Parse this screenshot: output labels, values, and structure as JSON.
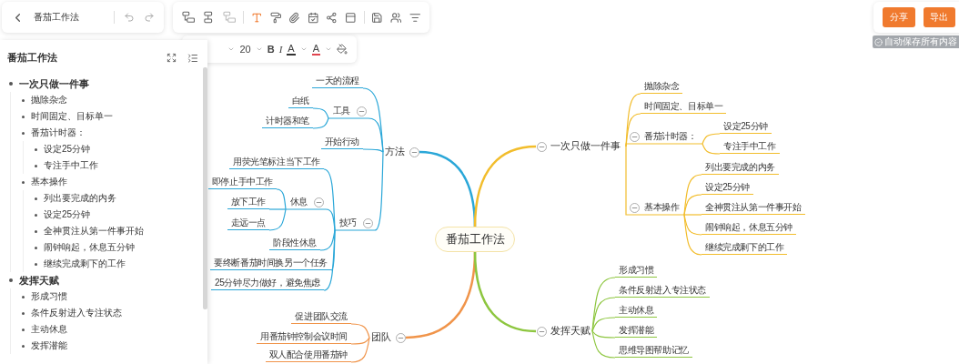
{
  "document": {
    "title": "番茄工作法"
  },
  "format_bar": {
    "font_size": "20",
    "bold": "B",
    "italic": "I",
    "font_color": {
      "label": "A",
      "color": "#333333"
    },
    "highlight": {
      "label": "A",
      "color": "#e0454f"
    }
  },
  "actions": [
    "分享",
    "导出"
  ],
  "autosave": "自动保存所有内容",
  "outline": {
    "title": "番茄工作法",
    "items": [
      {
        "text": "一次只做一件事",
        "children": [
          {
            "text": "抛除杂念"
          },
          {
            "text": "时间固定、目标单一"
          },
          {
            "text": "番茄计时器：",
            "children": [
              {
                "text": "设定25分钟"
              },
              {
                "text": "专注手中工作"
              }
            ]
          },
          {
            "text": "基本操作",
            "children": [
              {
                "text": "列出要完成的内务"
              },
              {
                "text": "设定25分钟"
              },
              {
                "text": "全神贯注从第一件事开始"
              },
              {
                "text": "闹钟响起，休息五分钟"
              },
              {
                "text": "继续完成剩下的工作"
              }
            ]
          }
        ]
      },
      {
        "text": "发挥天赋",
        "children": [
          {
            "text": "形成习惯"
          },
          {
            "text": "条件反射进入专注状态"
          },
          {
            "text": "主动休息"
          },
          {
            "text": "发挥潜能"
          }
        ]
      }
    ]
  },
  "mindmap": {
    "root": "番茄工作法",
    "branches": [
      {
        "text": "方法",
        "color": "#2aa7d8",
        "expanded": true,
        "children": [
          {
            "text": "一天的流程"
          },
          {
            "text": "工具",
            "expanded": true,
            "children": [
              {
                "text": "白纸"
              },
              {
                "text": "计时器和笔"
              }
            ]
          },
          {
            "text": "开始行动"
          },
          {
            "text": "技巧",
            "expanded": true,
            "children": [
              {
                "text": "用荧光笔标注当下工作"
              },
              {
                "text": "休息",
                "expanded": true,
                "children": [
                  {
                    "text": "即停止手中工作"
                  },
                  {
                    "text": "放下工作"
                  },
                  {
                    "text": "走远一点"
                  }
                ]
              },
              {
                "text": "阶段性休息"
              },
              {
                "text": "要终断番茄时间换另一个任务"
              },
              {
                "text": "25分钟尽力做好，避免焦虑"
              }
            ]
          }
        ]
      },
      {
        "text": "团队",
        "color": "#f0944a",
        "expanded": true,
        "children": [
          {
            "text": "促进团队交流"
          },
          {
            "text": "用番茄钟控制会议时间"
          },
          {
            "text": "双人配合使用番茄钟"
          }
        ]
      },
      {
        "text": "一次只做一件事",
        "color": "#f2bd2c",
        "expanded": true,
        "children": [
          {
            "text": "抛除杂念"
          },
          {
            "text": "时间固定、目标单一"
          },
          {
            "text": "番茄计时器：",
            "expanded": true,
            "children": [
              {
                "text": "设定25分钟"
              },
              {
                "text": "专注手中工作"
              }
            ]
          },
          {
            "text": "基本操作",
            "expanded": true,
            "children": [
              {
                "text": "列出要完成的内务"
              },
              {
                "text": "设定25分钟"
              },
              {
                "text": "全神贯注从第一件事开始"
              },
              {
                "text": "闹钟响起，休息五分钟"
              },
              {
                "text": "继续完成剩下的工作"
              }
            ]
          }
        ]
      },
      {
        "text": "发挥天赋",
        "color": "#8dc63f",
        "expanded": true,
        "children": [
          {
            "text": "形成习惯"
          },
          {
            "text": "条件反射进入专注状态"
          },
          {
            "text": "主动休息"
          },
          {
            "text": "发挥潜能"
          },
          {
            "text": "思维导图帮助记忆"
          }
        ]
      }
    ]
  }
}
